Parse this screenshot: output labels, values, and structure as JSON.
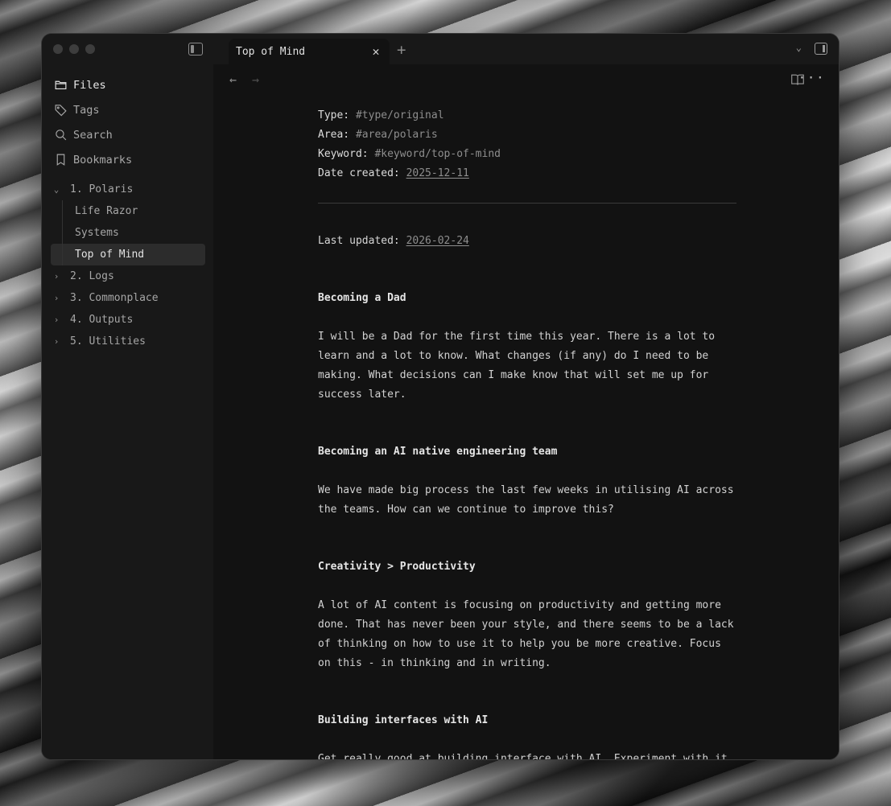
{
  "sidebar": {
    "nav": [
      {
        "label": "Files",
        "icon": "folder-icon"
      },
      {
        "label": "Tags",
        "icon": "tag-icon"
      },
      {
        "label": "Search",
        "icon": "search-icon"
      },
      {
        "label": "Bookmarks",
        "icon": "bookmark-icon"
      }
    ],
    "tree": {
      "open_folder": "1. Polaris",
      "children": [
        "Life Razor",
        "Systems",
        "Top of Mind"
      ],
      "folders": [
        "2. Logs",
        "3. Commonplace",
        "4. Outputs",
        "5. Utilities"
      ]
    }
  },
  "tab": {
    "title": "Top of Mind"
  },
  "doc": {
    "props": {
      "type_label": "Type:",
      "type_value": "#type/original",
      "area_label": "Area:",
      "area_value": "#area/polaris",
      "keyword_label": "Keyword:",
      "keyword_value": "#keyword/top-of-mind",
      "date_label": "Date created:",
      "date_value": "2025-12-11"
    },
    "updated_label": "Last updated:",
    "updated_value": "2026-02-24",
    "sections": [
      {
        "heading": "Becoming a Dad",
        "body": "I will be a Dad for the first time this year. There is a lot to learn and a lot to know. What changes (if any) do I need to be making. What decisions can I make know that will set me up for success later."
      },
      {
        "heading": "Becoming an AI native engineering team",
        "body": "We have made big process the last few weeks in utilising AI across the teams. How can we continue to improve this?"
      },
      {
        "heading": "Creativity > Productivity",
        "body": "A lot of AI content is focusing on productivity and getting more done. That has never been your style, and there seems to be a lack of thinking on how to use it to help you be more creative. Focus on this - in thinking and in writing."
      },
      {
        "heading": "Building interfaces with AI",
        "body": "Get really good at building interface with AI. Experiment with it, learn the"
      }
    ]
  }
}
